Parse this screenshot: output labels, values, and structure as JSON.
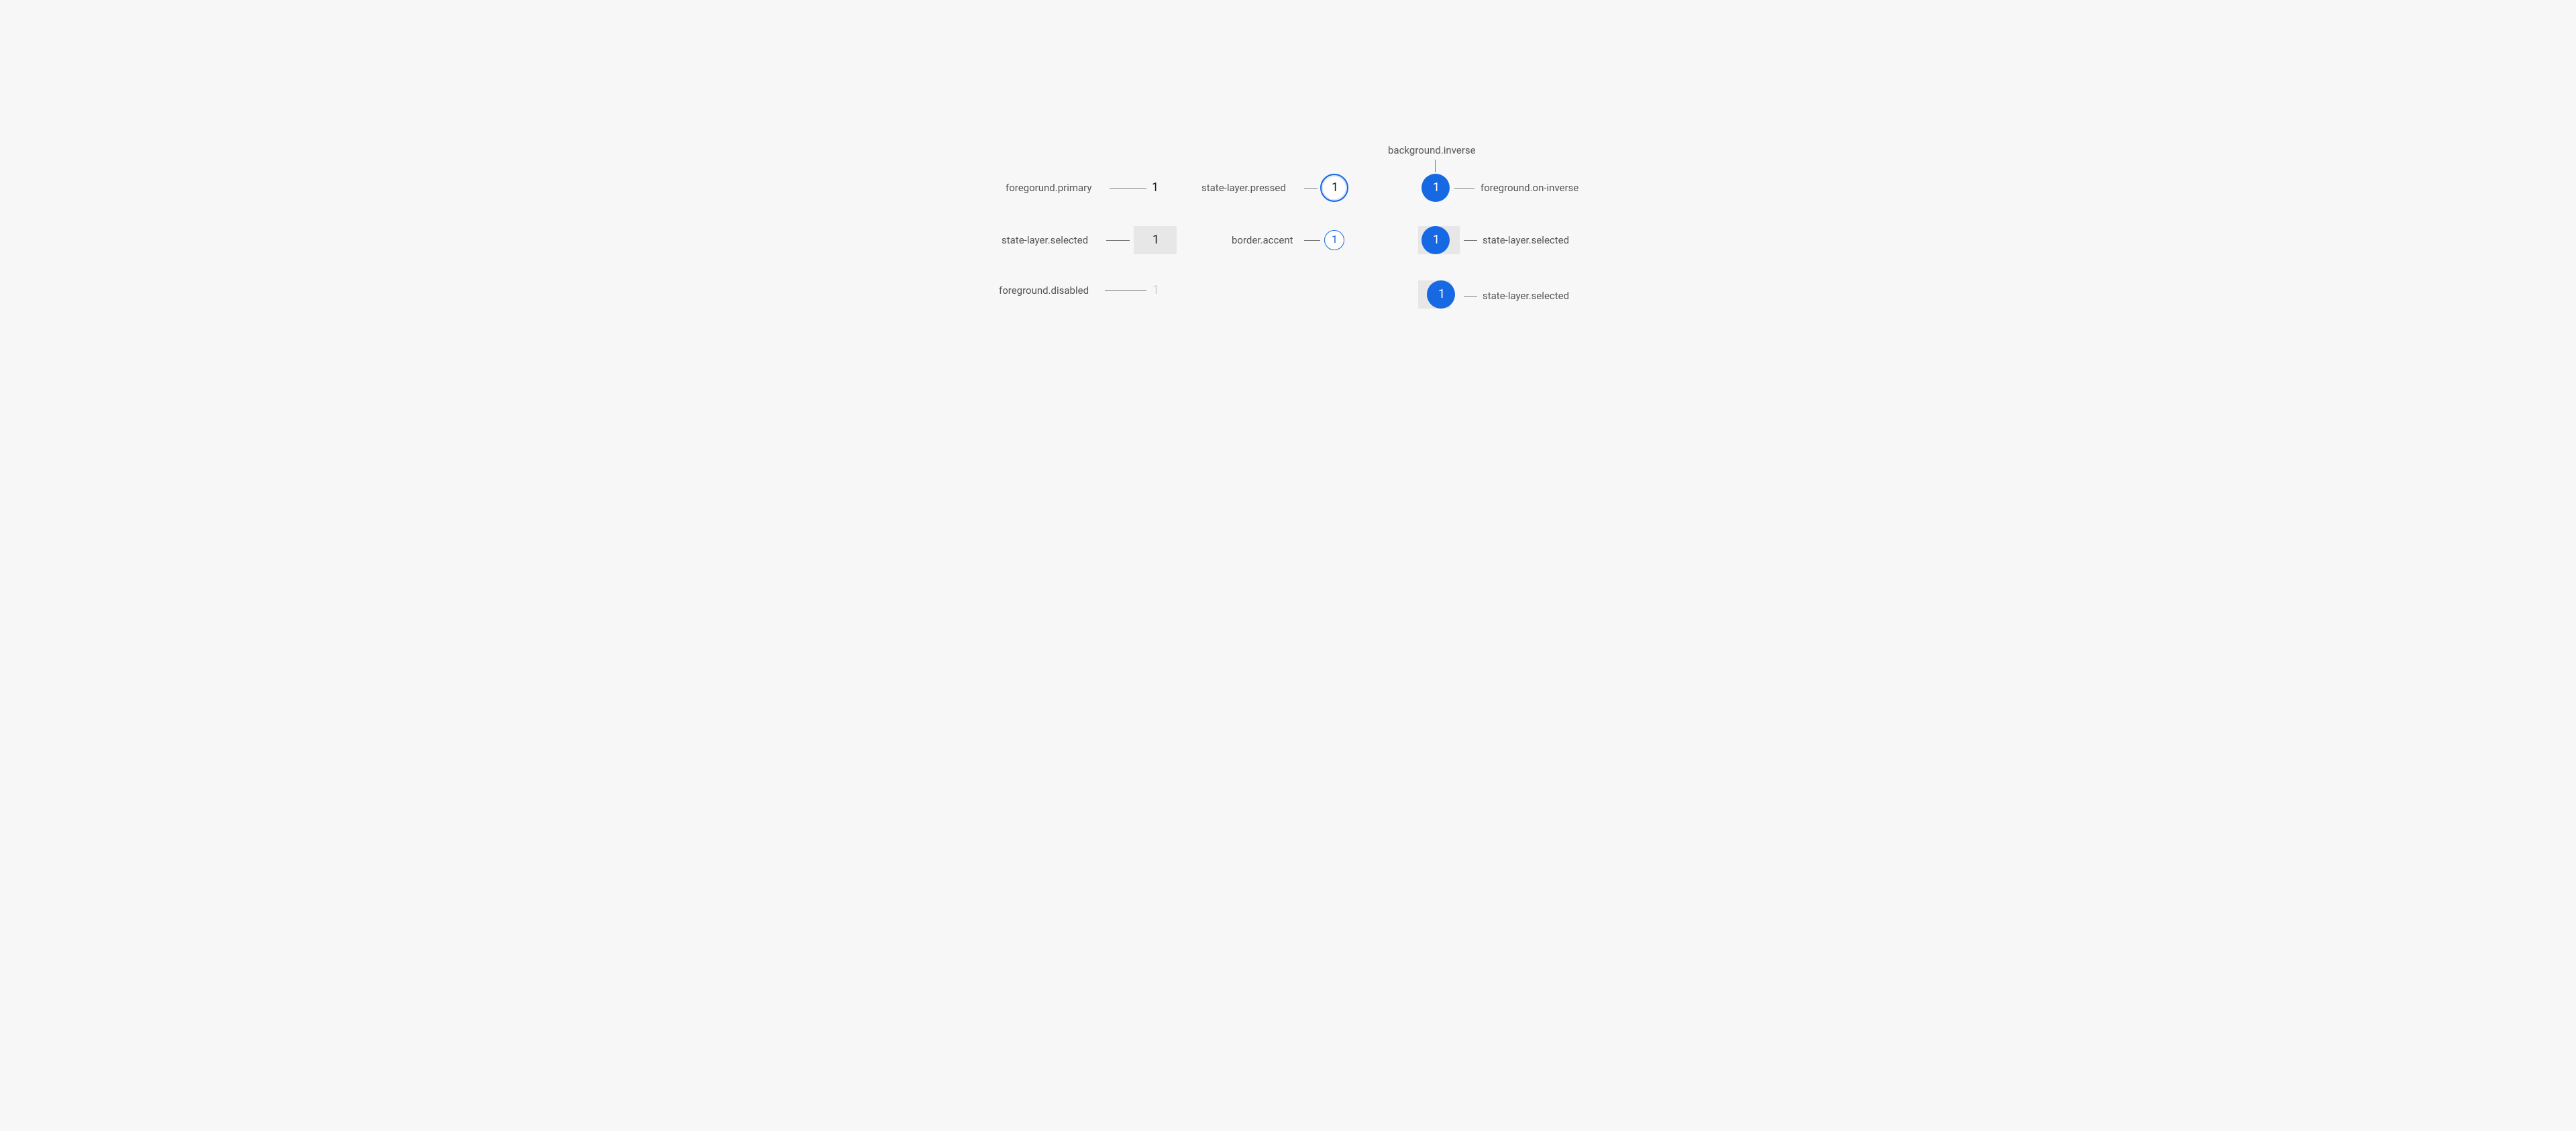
{
  "colors": {
    "background": "#f7f7f7",
    "text": "#555555",
    "primary_number": "#222222",
    "disabled_number": "#cfcfcf",
    "accent": "#1668e3",
    "state_selected_bg": "#e7e7e7",
    "on_inverse": "#ffffff"
  },
  "num": "1",
  "labels": {
    "col1_r1": "foregorund.primary",
    "col1_r2": "state-layer.selected",
    "col1_r3": "foreground.disabled",
    "col2_r1": "state-layer.pressed",
    "col2_r2": "border.accent",
    "col3_top": "background.inverse",
    "col3_r1": "foreground.on-inverse",
    "col3_r2": "state-layer.selected",
    "col3_r3": "state-layer.selected"
  }
}
